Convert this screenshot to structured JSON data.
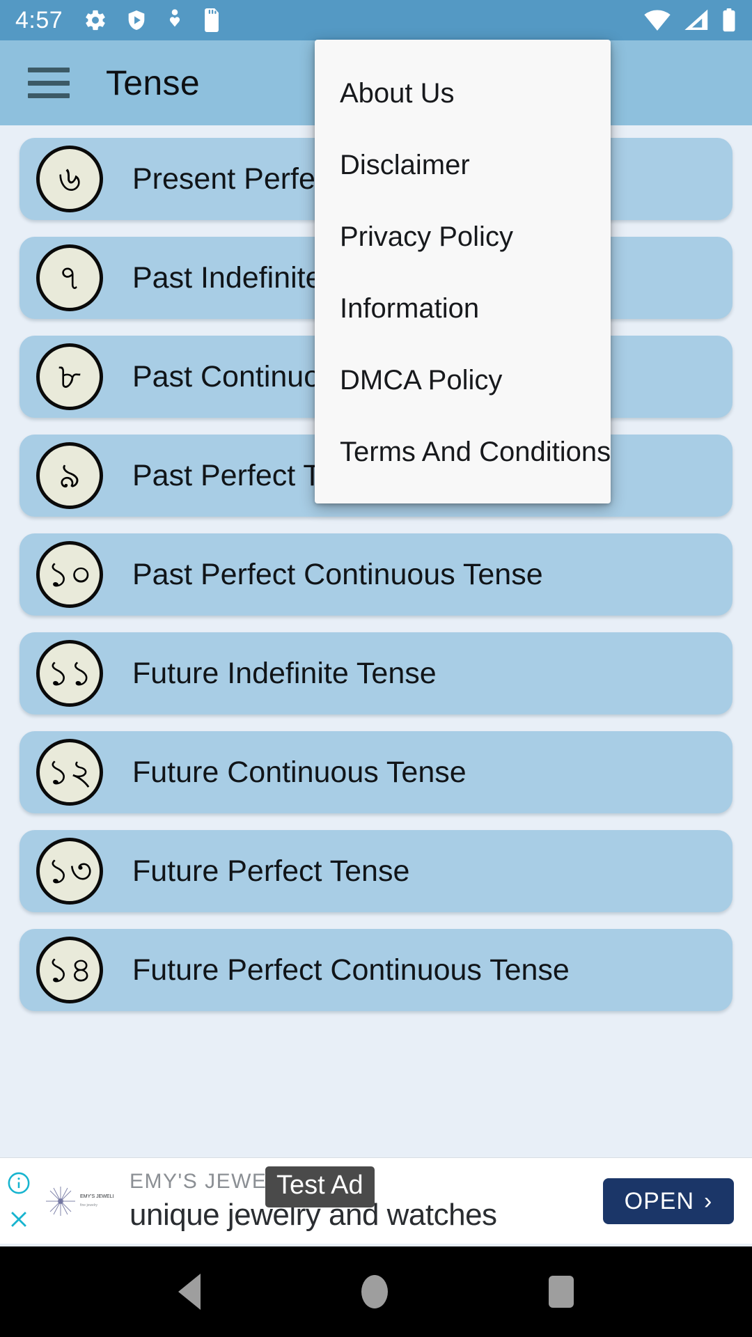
{
  "statusbar": {
    "time": "4:57",
    "left_icons": [
      "gear-icon",
      "play-protect-icon",
      "heart-person-icon",
      "sd-card-icon"
    ],
    "right_icons": [
      "wifi-icon",
      "cell-signal-icon",
      "battery-icon"
    ],
    "background_color": "#5499c4"
  },
  "appbar": {
    "title": "Tense",
    "menu_icon": "hamburger-menu-icon",
    "background_color": "#8ec0dd"
  },
  "menu": {
    "items": [
      {
        "label": "About Us"
      },
      {
        "label": "Disclaimer"
      },
      {
        "label": "Privacy Policy"
      },
      {
        "label": "Information"
      },
      {
        "label": "DMCA Policy"
      },
      {
        "label": "Terms And Conditions"
      }
    ],
    "background_color": "#f8f8f8"
  },
  "list": {
    "card_color": "#a8cde5",
    "badge_color": "#e9eada",
    "items": [
      {
        "number": "৬",
        "label": "Present Perfect Continuous Tense"
      },
      {
        "number": "৭",
        "label": "Past Indefinite Tense"
      },
      {
        "number": "৮",
        "label": "Past Continuous Tense"
      },
      {
        "number": "৯",
        "label": "Past Perfect Tense"
      },
      {
        "number": "১০",
        "label": "Past Perfect Continuous Tense"
      },
      {
        "number": "১১",
        "label": "Future Indefinite Tense"
      },
      {
        "number": "১২",
        "label": "Future Continuous Tense"
      },
      {
        "number": "১৩",
        "label": "Future Perfect Tense"
      },
      {
        "number": "১৪",
        "label": "Future Perfect Continuous Tense"
      }
    ]
  },
  "ad": {
    "test_label": "Test Ad",
    "brand": "EMY'S JEWELLERY",
    "headline": "unique jewelry and watches",
    "open_button": "OPEN",
    "open_chevron": "›",
    "info_icon": "info-icon",
    "close_icon": "close-icon",
    "open_button_color": "#1b3668"
  },
  "navbar": {
    "back": "back-triangle-icon",
    "home": "home-circle-icon",
    "recent": "recent-square-icon"
  }
}
